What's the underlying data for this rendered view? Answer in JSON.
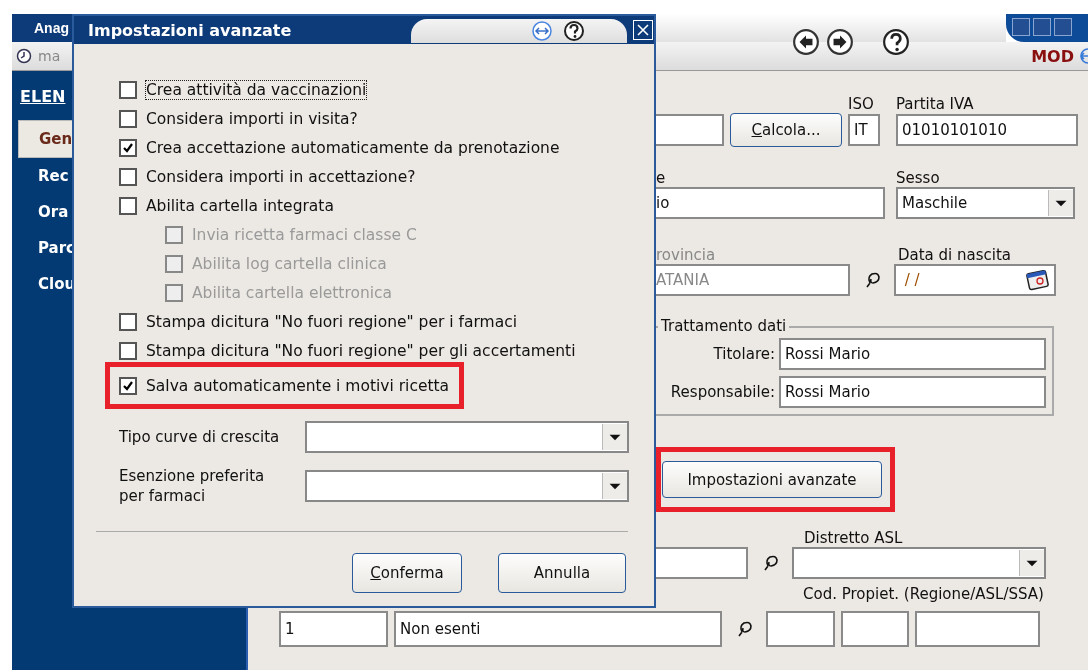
{
  "window": {
    "title": "Anag",
    "toolbar_text": "ma",
    "mode": "MOD"
  },
  "sidebar": {
    "heading": "ELEN",
    "items": [
      {
        "label": "Gen",
        "selected": true
      },
      {
        "label": "Rec",
        "selected": false
      },
      {
        "label": "Ora",
        "selected": false
      },
      {
        "label": "Parc",
        "selected": false
      },
      {
        "label": "Clou",
        "selected": false
      }
    ]
  },
  "form": {
    "calcola_button": {
      "label": "Calcola...",
      "mnemonic": true
    },
    "iso": {
      "label": "ISO",
      "value": "IT"
    },
    "partita_iva": {
      "label": "Partita IVA",
      "value": "01010101010"
    },
    "field_1": {
      "label": "e",
      "value": "io"
    },
    "sesso": {
      "label": "Sesso",
      "value": "Maschile"
    },
    "provincia": {
      "label": "rovincia",
      "value": "ATANIA",
      "disabled": true
    },
    "data_nascita": {
      "label": "Data di nascita",
      "value": " / /"
    },
    "trattamento": {
      "title": "Trattamento dati",
      "fields": [
        {
          "label": "Titolare:",
          "value": "Rossi Mario"
        },
        {
          "label": "Responsabile:",
          "value": "Rossi Mario"
        }
      ]
    },
    "advanced_button": {
      "label": "Impostazioni avanzate",
      "highlighted": true
    },
    "distretto": {
      "label": "Distretto ASL"
    },
    "esenzione": {
      "code": "1",
      "value": "Non esenti"
    },
    "cod_propiet": {
      "label": "Cod. Propiet. (Regione/ASL/SSA)"
    }
  },
  "dialog": {
    "title": "Impostazioni avanzate",
    "options": [
      {
        "label": "Crea attività da vaccinazioni",
        "checked": false,
        "disabled": false,
        "focused": true,
        "highlighted": false
      },
      {
        "label": "Considera importi in visita?",
        "checked": false,
        "disabled": false,
        "focused": false,
        "highlighted": false
      },
      {
        "label": "Crea accettazione automaticamente da prenotazione",
        "checked": true,
        "disabled": false,
        "focused": false,
        "highlighted": false
      },
      {
        "label": "Considera importi in accettazione?",
        "checked": false,
        "disabled": false,
        "focused": false,
        "highlighted": false
      },
      {
        "label": "Abilita cartella integrata",
        "checked": false,
        "disabled": false,
        "focused": false,
        "highlighted": false,
        "children": [
          {
            "label": "Invia ricetta farmaci classe C",
            "checked": false,
            "disabled": true,
            "focused": false,
            "highlighted": false
          },
          {
            "label": "Abilita log cartella clinica",
            "checked": false,
            "disabled": true,
            "focused": false,
            "highlighted": false
          },
          {
            "label": "Abilita cartella elettronica",
            "checked": false,
            "disabled": true,
            "focused": false,
            "highlighted": false
          }
        ]
      },
      {
        "label": "Stampa dicitura \"No fuori regione\" per i farmaci",
        "checked": false,
        "disabled": false,
        "focused": false,
        "highlighted": false
      },
      {
        "label": "Stampa dicitura \"No fuori regione\" per gli accertamenti",
        "checked": false,
        "disabled": false,
        "focused": false,
        "highlighted": false
      },
      {
        "label": "Salva automaticamente i motivi ricetta",
        "checked": true,
        "disabled": false,
        "focused": false,
        "highlighted": true
      }
    ],
    "selects": [
      {
        "label": "Tipo curve di crescita"
      },
      {
        "label": "Esenzione preferita per farmaci"
      }
    ],
    "buttons": [
      {
        "label": "Conferma",
        "mnemonic": true
      },
      {
        "label": "Annulla",
        "mnemonic": false
      }
    ]
  }
}
